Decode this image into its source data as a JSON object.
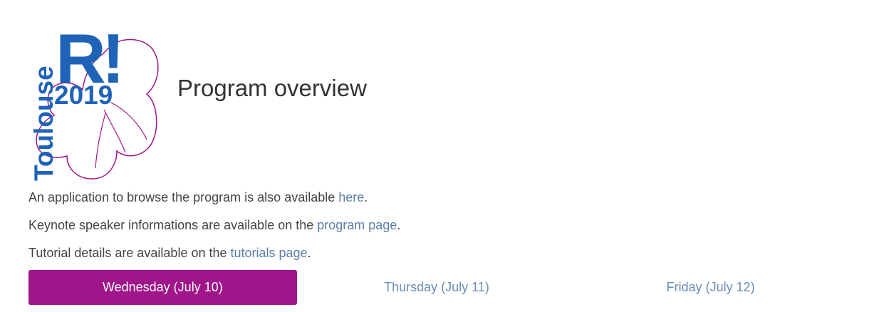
{
  "logo": {
    "city_text": "Toulouse",
    "letter": "R!",
    "year": "2019",
    "colors": {
      "blue": "#1f63b8",
      "magenta": "#a0158a"
    }
  },
  "page": {
    "title": "Program overview"
  },
  "info": [
    {
      "before": "An application to browse the program is also available ",
      "link": "here",
      "after": "."
    },
    {
      "before": "Keynote speaker informations are available on the ",
      "link": "program page",
      "after": "."
    },
    {
      "before": "Tutorial details are available on the ",
      "link": "tutorials page",
      "after": "."
    }
  ],
  "tabs": [
    {
      "label": "Wednesday (July 10)",
      "active": true
    },
    {
      "label": "Thursday (July 11)",
      "active": false
    },
    {
      "label": "Friday (July 12)",
      "active": false
    }
  ],
  "colors": {
    "accent": "#a0158a",
    "link": "#5b7ea6",
    "text": "#444444"
  }
}
